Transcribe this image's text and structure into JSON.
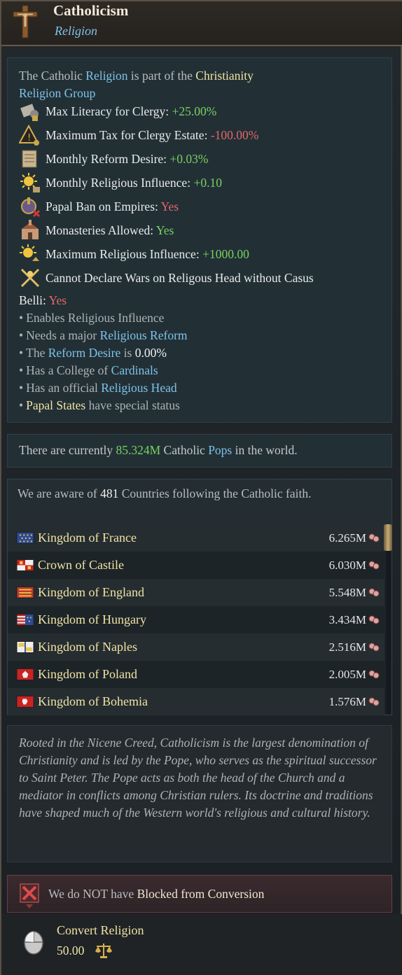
{
  "header": {
    "title": "Catholicism",
    "subtitle": "Religion"
  },
  "intro": {
    "p1": "The Catholic ",
    "religion_link": "Religion",
    "p2": " is part of the ",
    "group_link_1": "Christianity",
    "group_link_2": "Religion Group"
  },
  "effects": [
    {
      "icon": "literacy-clergy-icon",
      "label": "Max Literacy for Clergy",
      "value": "+25.00%",
      "tone": "green"
    },
    {
      "icon": "tax-clergy-icon",
      "label": "Maximum Tax for Clergy Estate",
      "value": "-100.00%",
      "tone": "red"
    },
    {
      "icon": "reform-desire-icon",
      "label": "Monthly Reform Desire",
      "value": "+0.03%",
      "tone": "green"
    },
    {
      "icon": "religious-influence-icon",
      "label": "Monthly Religious Influence",
      "value": "+0.10",
      "tone": "green"
    },
    {
      "icon": "papal-ban-icon",
      "label": "Papal Ban on Empires",
      "value": "Yes",
      "tone": "red"
    },
    {
      "icon": "monastery-icon",
      "label": "Monasteries Allowed",
      "value": "Yes",
      "tone": "green"
    },
    {
      "icon": "max-religious-influence-icon",
      "label": "Maximum Religious Influence",
      "value": "+1000.00",
      "tone": "green"
    },
    {
      "icon": "crossed-swords-icon",
      "label": "Cannot Declare Wars on Religous Head without Casus",
      "value": "",
      "tone": "green"
    }
  ],
  "belli": {
    "label": "Belli",
    "value": "Yes"
  },
  "bullets": {
    "b1": "Enables Religious Influence",
    "b2_pre": "Needs a major ",
    "b2_link": "Religious Reform",
    "b3_pre": "The ",
    "b3_link": "Reform Desire",
    "b3_mid": " is ",
    "b3_val": "0.00%",
    "b4_pre": "Has a College of ",
    "b4_link": "Cardinals",
    "b5_pre": "Has an official ",
    "b5_link": "Religious Head",
    "b6_link": "Papal States",
    "b6_post": " have special status"
  },
  "pops": {
    "pre": "There are currently ",
    "value": "85.324M",
    "mid": " Catholic ",
    "link": "Pops",
    "post": " in the world."
  },
  "countries": {
    "header_pre": "We are aware of ",
    "count": "481",
    "header_post": " Countries following the Catholic faith.",
    "rows": [
      {
        "name": "Kingdom of France",
        "pop": "6.265M",
        "flag": "france"
      },
      {
        "name": "Crown of Castile",
        "pop": "6.030M",
        "flag": "castile"
      },
      {
        "name": "Kingdom of England",
        "pop": "5.548M",
        "flag": "england"
      },
      {
        "name": "Kingdom of Hungary",
        "pop": "3.434M",
        "flag": "hungary"
      },
      {
        "name": "Kingdom of Naples",
        "pop": "2.516M",
        "flag": "naples"
      },
      {
        "name": "Kingdom of Poland",
        "pop": "2.005M",
        "flag": "poland"
      },
      {
        "name": "Kingdom of Bohemia",
        "pop": "1.576M",
        "flag": "bohemia"
      }
    ]
  },
  "description": "Rooted in the Nicene Creed, Catholicism is the largest denomination of Christianity and is led by the Pope, who serves as the spiritual successor to Saint Peter. The Pope acts as both the head of the Church and a mediator in conflicts among Christian rulers. Its doctrine and traditions have shaped much of the Western world's religious and cultural history.",
  "block": {
    "pre": "We do NOT have ",
    "value": "Blocked from Conversion"
  },
  "action": {
    "label": "Convert Religion",
    "cost": "50.00"
  }
}
